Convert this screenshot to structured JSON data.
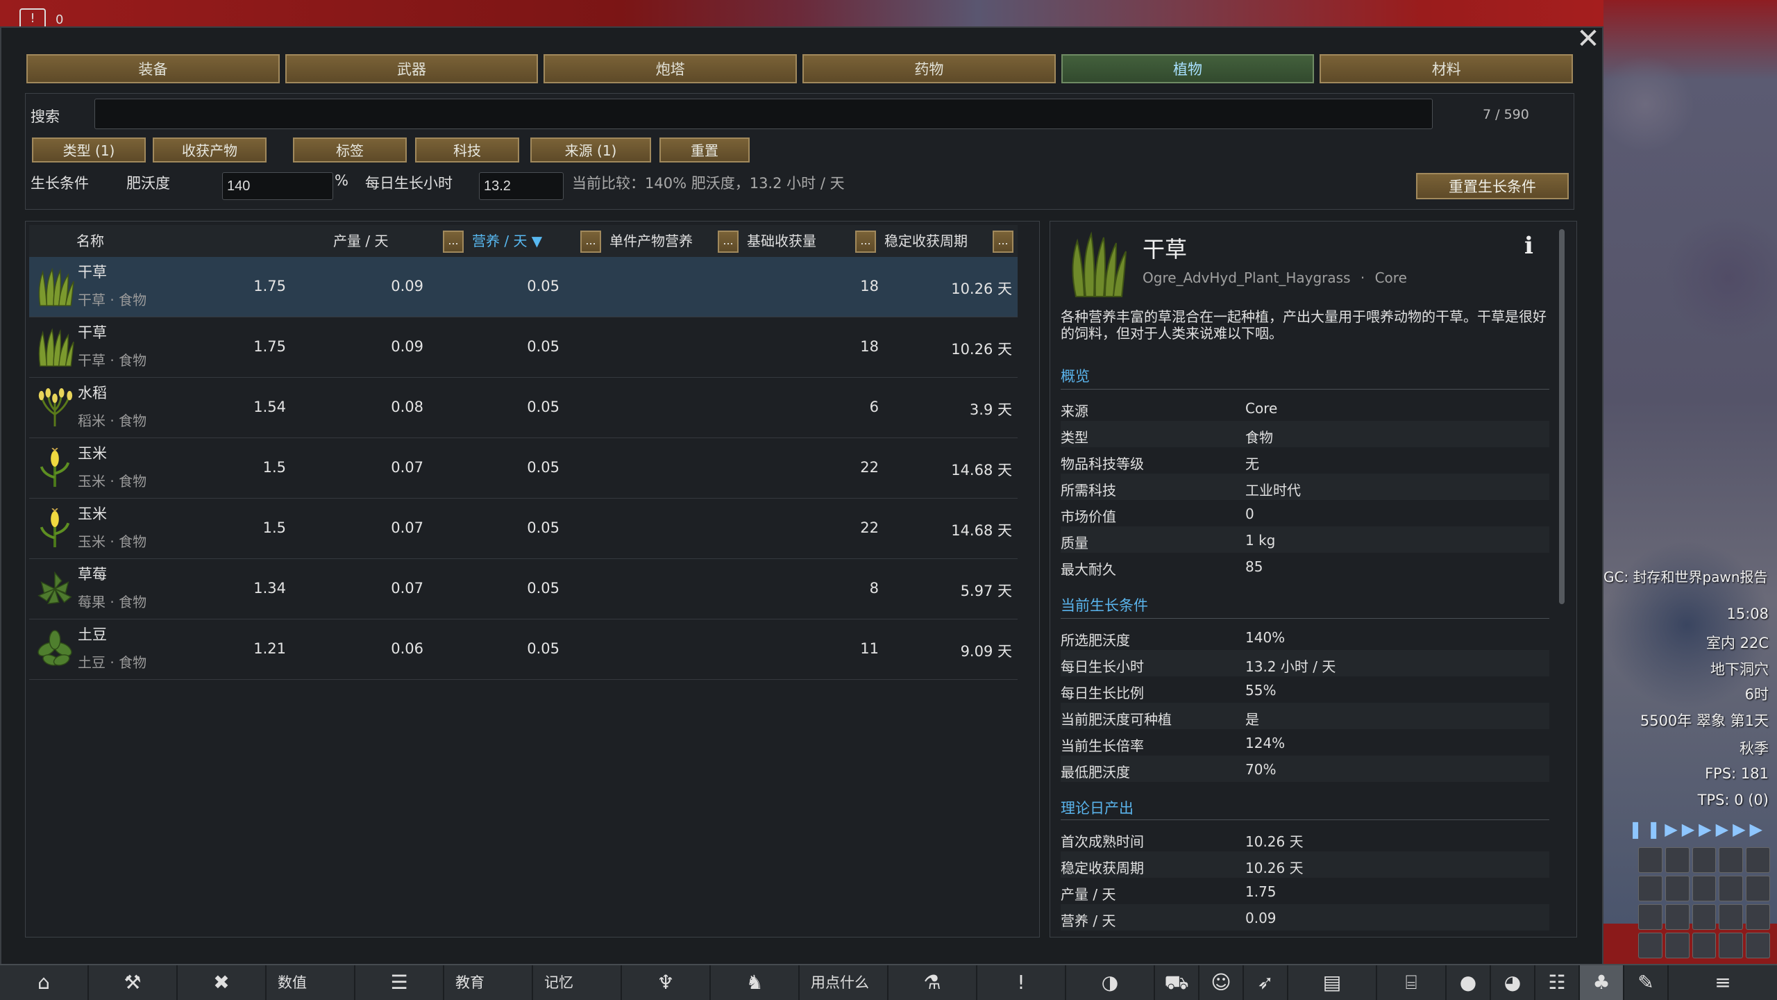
{
  "top_left": {
    "count": "0"
  },
  "categories": [
    "装备",
    "武器",
    "炮塔",
    "药物",
    "植物",
    "材料"
  ],
  "active_category": 4,
  "search": {
    "label": "搜索",
    "value": "",
    "count": "7 / 590"
  },
  "filters": [
    "类型 (1)",
    "收获产物",
    "标签",
    "科技",
    "来源 (1)",
    "重置"
  ],
  "grow": {
    "label": "生长条件",
    "fertility_label": "肥沃度",
    "fertility_value": "140",
    "percent": "%",
    "hours_label": "每日生长小时",
    "hours_value": "13.2",
    "compare": "当前比较：140% 肥沃度，13.2 小时 / 天",
    "reset_label": "重置生长条件"
  },
  "table": {
    "headers": {
      "name": "名称",
      "yield": "产量 / 天",
      "nutrition": "营养 / 天 ▼",
      "unit_nutrition": "单件产物营养",
      "base_harvest": "基础收获量",
      "cycle": "稳定收获周期",
      "dots": "..."
    },
    "rows": [
      {
        "name": "干草",
        "sub": "干草 · 食物",
        "yield": "1.75",
        "nutrition": "0.09",
        "unit": "0.05",
        "harvest": "18",
        "cycle": "10.26 天",
        "icon": "haygrass-icon"
      },
      {
        "name": "干草",
        "sub": "干草 · 食物",
        "yield": "1.75",
        "nutrition": "0.09",
        "unit": "0.05",
        "harvest": "18",
        "cycle": "10.26 天",
        "icon": "haygrass-icon"
      },
      {
        "name": "水稻",
        "sub": "稻米 · 食物",
        "yield": "1.54",
        "nutrition": "0.08",
        "unit": "0.05",
        "harvest": "6",
        "cycle": "3.9 天",
        "icon": "rice-icon"
      },
      {
        "name": "玉米",
        "sub": "玉米 · 食物",
        "yield": "1.5",
        "nutrition": "0.07",
        "unit": "0.05",
        "harvest": "22",
        "cycle": "14.68 天",
        "icon": "corn-icon"
      },
      {
        "name": "玉米",
        "sub": "玉米 · 食物",
        "yield": "1.5",
        "nutrition": "0.07",
        "unit": "0.05",
        "harvest": "22",
        "cycle": "14.68 天",
        "icon": "corn-icon"
      },
      {
        "name": "草莓",
        "sub": "莓果 · 食物",
        "yield": "1.34",
        "nutrition": "0.07",
        "unit": "0.05",
        "harvest": "8",
        "cycle": "5.97 天",
        "icon": "strawberry-icon"
      },
      {
        "name": "土豆",
        "sub": "土豆 · 食物",
        "yield": "1.21",
        "nutrition": "0.06",
        "unit": "0.05",
        "harvest": "11",
        "cycle": "9.09 天",
        "icon": "potato-icon"
      }
    ]
  },
  "detail": {
    "title": "干草",
    "def_name": "Ogre_AdvHyd_Plant_Haygrass",
    "sep": "·",
    "source": "Core",
    "info": "i",
    "desc": "各种营养丰富的草混合在一起种植，产出大量用于喂养动物的干草。干草是很好的饲料，但对于人类来说难以下咽。",
    "overview_title": "概览",
    "overview": [
      {
        "k": "来源",
        "v": "Core"
      },
      {
        "k": "类型",
        "v": "食物"
      },
      {
        "k": "物品科技等级",
        "v": "无"
      },
      {
        "k": "所需科技",
        "v": "工业时代"
      },
      {
        "k": "市场价值",
        "v": "0"
      },
      {
        "k": "质量",
        "v": "1 kg"
      },
      {
        "k": "最大耐久",
        "v": "85"
      }
    ],
    "grow_title": "当前生长条件",
    "grow": [
      {
        "k": "所选肥沃度",
        "v": "140%"
      },
      {
        "k": "每日生长小时",
        "v": "13.2 小时 / 天"
      },
      {
        "k": "每日生长比例",
        "v": "55%"
      },
      {
        "k": "当前肥沃度可种植",
        "v": "是"
      },
      {
        "k": "当前生长倍率",
        "v": "124%"
      },
      {
        "k": "最低肥沃度",
        "v": "70%"
      }
    ],
    "output_title": "理论日产出",
    "output": [
      {
        "k": "首次成熟时间",
        "v": "10.26 天"
      },
      {
        "k": "稳定收获周期",
        "v": "10.26 天"
      },
      {
        "k": "产量 / 天",
        "v": "1.75"
      },
      {
        "k": "营养 / 天",
        "v": "0.09"
      }
    ]
  },
  "bottom_bar": {
    "stats": "数值",
    "education": "教育",
    "memory": "记忆",
    "what_use": "用点什么"
  },
  "hud": {
    "gc": "GC: 封存和世界pawn报告",
    "time": "15:08",
    "temp": "室内 22C",
    "location": "地下洞穴",
    "hour": "6时",
    "date": "5500年 翠象 第1天",
    "season": "秋季",
    "fps": "FPS: 181",
    "tps": "TPS: 0 (0)"
  }
}
